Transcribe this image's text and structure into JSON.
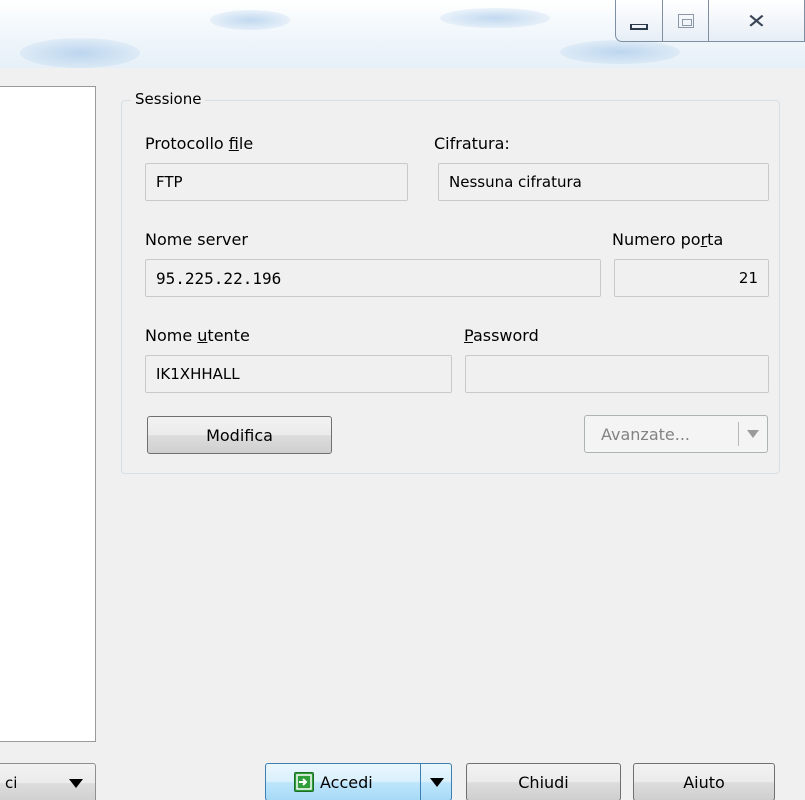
{
  "window": {
    "controls": {
      "minimize_icon": "minimize-icon",
      "maximize_icon": "maximize-icon",
      "close_icon": "close-icon",
      "close_glyph": "✕"
    }
  },
  "left": {
    "dropdown_label": "ci"
  },
  "session": {
    "legend": "Sessione",
    "protocol": {
      "label_pre": "Protocollo ",
      "label_underline": "f",
      "label_post": "ile",
      "value": "FTP"
    },
    "encryption": {
      "label": "Cifratura:",
      "value": "Nessuna cifratura"
    },
    "server": {
      "label": "Nome server",
      "value": "95.225.22.196"
    },
    "port": {
      "label_pre": "Numero po",
      "label_underline": "r",
      "label_post": "ta",
      "value": "21"
    },
    "user": {
      "label_pre": "Nome ",
      "label_underline": "u",
      "label_post": "tente",
      "value": "IK1XHHALL"
    },
    "password": {
      "label_underline": "P",
      "label_post": "assword",
      "value": ""
    },
    "edit_button": "Modifica",
    "advanced_button": "Avanzate..."
  },
  "footer": {
    "login": "Accedi",
    "close": "Chiudi",
    "help": "Aiuto"
  },
  "colors": {
    "accent": "#3c7fb1",
    "login_icon": "#2f9e3a"
  }
}
